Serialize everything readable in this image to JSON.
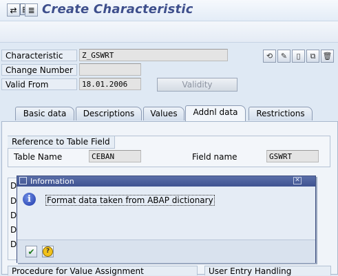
{
  "window": {
    "title": "Create Characteristic"
  },
  "header": {
    "characteristic_label": "Characteristic",
    "characteristic_value": "Z_GSWRT",
    "change_number_label": "Change Number",
    "change_number_value": "",
    "valid_from_label": "Valid From",
    "valid_from_value": "18.01.2006",
    "validity_button": "Validity"
  },
  "tabs": [
    "Basic data",
    "Descriptions",
    "Values",
    "Addnl data",
    "Restrictions"
  ],
  "active_tab": "Addnl data",
  "reference": {
    "group_title": "Reference to Table Field",
    "table_name_label": "Table Name",
    "table_name_value": "CEBAN",
    "field_name_label": "Field name",
    "field_name_value": "GSWRT"
  },
  "hidden_group": {
    "title_fragment": "D",
    "row_fragments": [
      "D",
      "D",
      "D",
      "D"
    ]
  },
  "dialog": {
    "title": "Information",
    "message": "Format data taken from ABAP dictionary",
    "icon": "info-icon"
  },
  "bottom_groups": [
    "Procedure for Value Assignment",
    "User Entry Handling"
  ],
  "colors": {
    "title_text": "#3e4f8c",
    "dialog_titlebar": "#4a5e9c",
    "background": "#dfe9f4"
  }
}
